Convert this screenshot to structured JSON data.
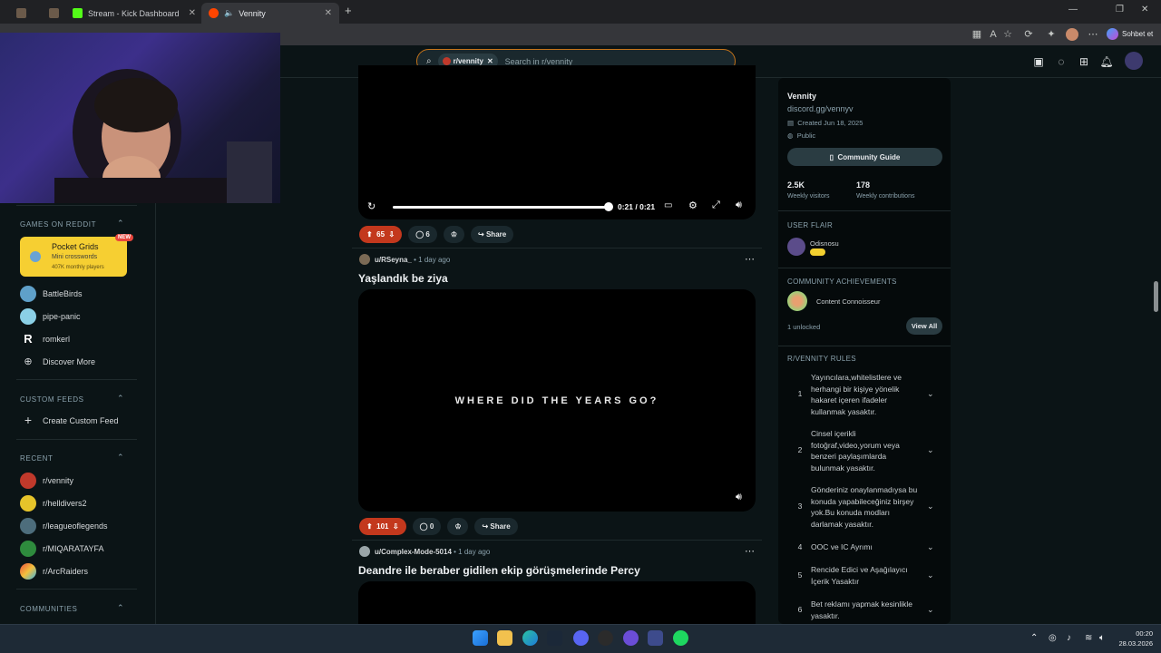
{
  "browser": {
    "tabs": [
      {
        "label": "",
        "active": false
      },
      {
        "label": "",
        "active": false
      },
      {
        "label": "Stream - Kick Dashboard",
        "active": false
      },
      {
        "label": "Vennity",
        "active": true
      }
    ],
    "profile_label": "Sohbet et"
  },
  "header": {
    "search_chip": "r/vennity",
    "search_placeholder": "Search in r/vennity"
  },
  "sidebar": {
    "games_title": "GAMES ON REDDIT",
    "featured_game": {
      "name": "Pocket Grids",
      "subtitle": "Mini crosswords",
      "players": "407K monthly players",
      "badge": "NEW"
    },
    "games": [
      "BattleBirds",
      "pipe-panic",
      "romkerl",
      "Discover More"
    ],
    "custom_feeds_title": "CUSTOM FEEDS",
    "create_feed": "Create Custom Feed",
    "recent_title": "RECENT",
    "recent": [
      "r/vennity",
      "r/helldivers2",
      "r/leagueoflegends",
      "r/MIQARATAYFA",
      "r/ArcRaiders"
    ],
    "communities_title": "COMMUNITIES"
  },
  "feed": {
    "post1": {
      "time": "0:21 / 0:21",
      "progress": 1.0,
      "votes": "65",
      "comments": "6",
      "share": "Share"
    },
    "post2": {
      "author": "u/RSeyna_",
      "time": "1 day ago",
      "title": "Yaşlandık be ziya",
      "video_text": "WHERE DID THE YEARS GO?",
      "votes": "101",
      "comments": "0",
      "share": "Share"
    },
    "post3": {
      "author": "u/Complex-Mode-5014",
      "time": "1 day ago",
      "title": "Deandre ile beraber gidilen ekip görüşmelerinde Percy"
    }
  },
  "right_sidebar": {
    "name": "Vennity",
    "link": "discord.gg/vennyv",
    "created": "Created Jun 18, 2025",
    "visibility": "Public",
    "guide_button": "Community Guide",
    "visitors": "2.5K",
    "visitors_label": "Weekly visitors",
    "contributions": "178",
    "contributions_label": "Weekly contributions",
    "flair_title": "USER FLAIR",
    "flair_user": "Odisnosu",
    "achievements_title": "COMMUNITY ACHIEVEMENTS",
    "achievement": "Content Connoisseur",
    "unlocked": "1 unlocked",
    "view_all": "View All",
    "rules_title": "R/VENNITY RULES",
    "rules": [
      {
        "num": "1",
        "text": "Yayıncılara,whitelistlere ve herhangi bir kişiye yönelik hakaret içeren ifadeler kullanmak yasaktır."
      },
      {
        "num": "2",
        "text": "Cinsel içerikli fotoğraf,video,yorum veya benzeri paylaşımlarda bulunmak yasaktır."
      },
      {
        "num": "3",
        "text": "Gönderiniz onaylanmadıysa bu konuda yapabileceğiniz birşey yok.Bu konuda modları darlamak yasaktır."
      },
      {
        "num": "4",
        "text": "OOC ve IC Ayrımı"
      },
      {
        "num": "5",
        "text": "Rencide Edici ve Aşağılayıcı İçerik Yasaktır"
      },
      {
        "num": "6",
        "text": "Bet reklamı yapmak kesinlikle yasaktır."
      }
    ]
  },
  "taskbar": {
    "time": "00:20",
    "date": "28.03.2026"
  }
}
